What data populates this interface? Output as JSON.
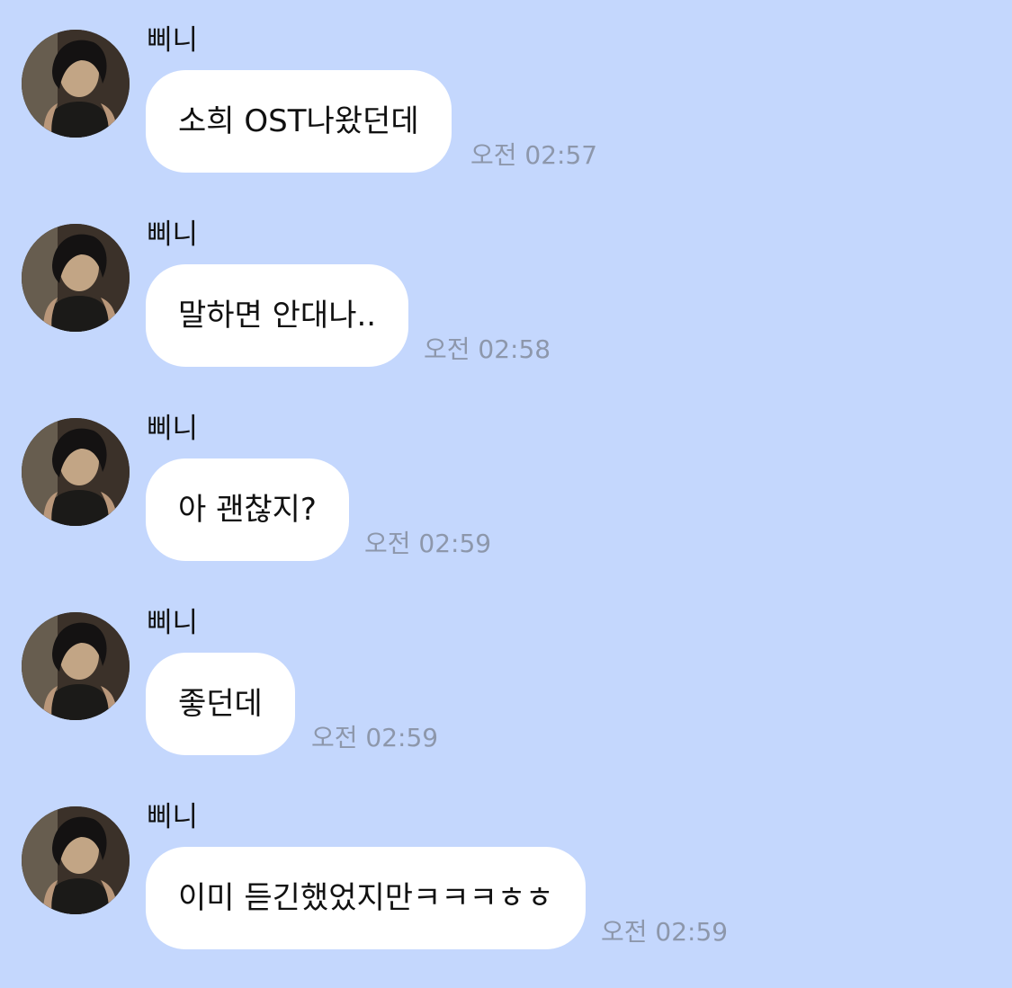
{
  "chat": {
    "messages": [
      {
        "sender": "삐니",
        "text": "소희 OST나왔던데",
        "time": "오전 02:57"
      },
      {
        "sender": "삐니",
        "text": "말하면 안대나..",
        "time": "오전 02:58"
      },
      {
        "sender": "삐니",
        "text": "아 괜찮지?",
        "time": "오전 02:59"
      },
      {
        "sender": "삐니",
        "text": "좋던데",
        "time": "오전 02:59"
      },
      {
        "sender": "삐니",
        "text": "이미 듣긴했었지만ㅋㅋㅋㅎㅎ",
        "time": "오전 02:59"
      }
    ]
  },
  "colors": {
    "background": "#c4d7fd",
    "bubble": "#ffffff",
    "timestamp": "#8d97ab",
    "text": "#111111"
  },
  "icons": {
    "avatar": "profile-photo"
  }
}
